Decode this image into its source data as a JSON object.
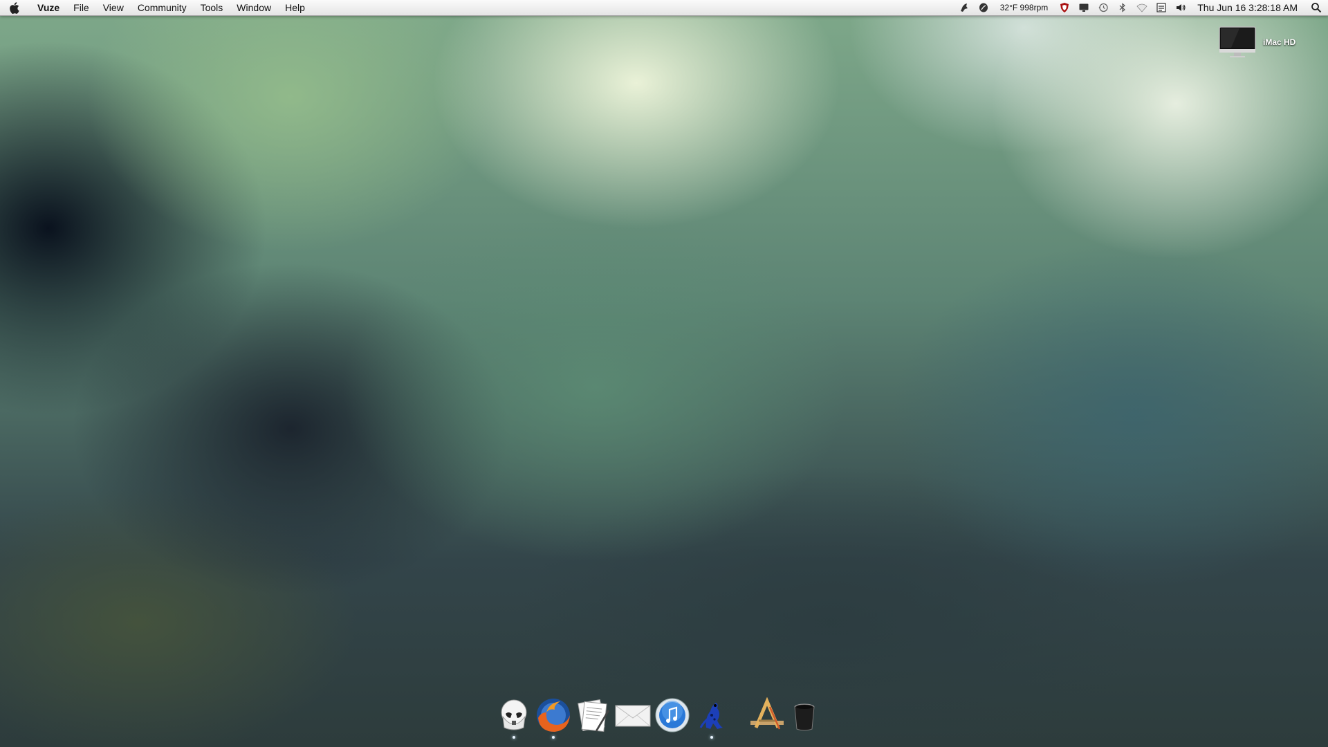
{
  "menubar": {
    "app_name": "Vuze",
    "menus": [
      "File",
      "View",
      "Community",
      "Tools",
      "Window",
      "Help"
    ],
    "status": {
      "sensor": "32°F 998rpm",
      "clock": "Thu Jun 16  3:28:18 AM"
    },
    "status_icons": [
      "growl-icon",
      "leaf-icon",
      "shield-icon",
      "display-icon",
      "time-machine-icon",
      "bluetooth-icon",
      "wifi-icon",
      "keyboard-icon",
      "volume-icon",
      "spotlight-icon"
    ]
  },
  "desktop": {
    "drive_label": "iMac HD"
  },
  "dock": {
    "items": [
      {
        "name": "stormtrooper-app",
        "running": true
      },
      {
        "name": "firefox",
        "running": true
      },
      {
        "name": "textedit",
        "running": false
      },
      {
        "name": "mail",
        "running": false
      },
      {
        "name": "itunes",
        "running": false
      },
      {
        "name": "vuze",
        "running": true
      },
      {
        "name": "applications-folder",
        "running": false
      },
      {
        "name": "trash",
        "running": false
      }
    ]
  }
}
